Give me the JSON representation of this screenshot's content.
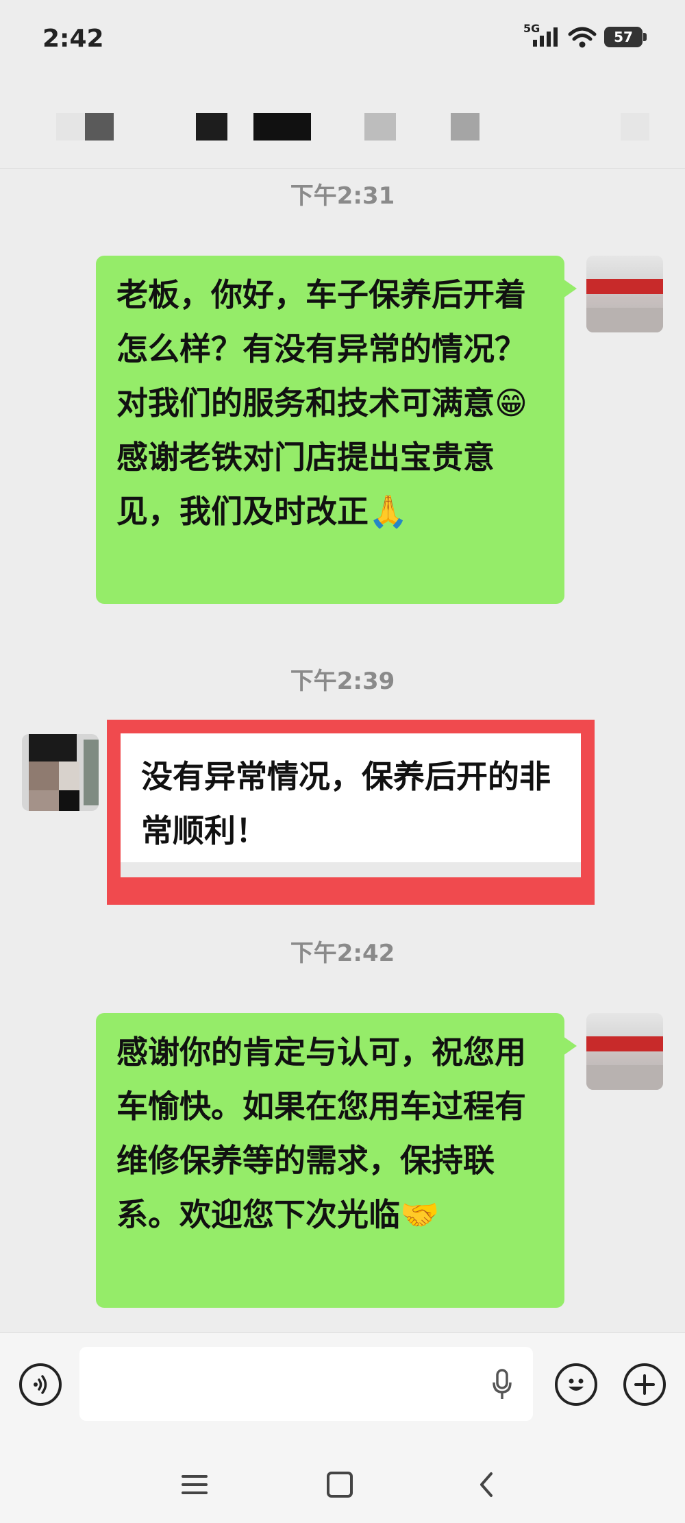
{
  "status_bar": {
    "time": "2:42",
    "signal_label": "5G",
    "battery_level": "57"
  },
  "messages": [
    {
      "type": "timestamp",
      "text": "下午2:31"
    },
    {
      "type": "sent",
      "text": "老板，你好，车子保养后开着怎么样？有没有异常的情况？对我们的服务和技术可满意😁感谢老铁对门店提出宝贵意见，我们及时改正🙏"
    },
    {
      "type": "timestamp",
      "text": "下午2:39"
    },
    {
      "type": "received",
      "text": "没有异常情况，保养后开的非常顺利！"
    },
    {
      "type": "timestamp",
      "text": "下午2:42"
    },
    {
      "type": "sent",
      "text": "感谢你的肯定与认可，祝您用车愉快。如果在您用车过程有维修保养等的需求，保持联系。欢迎您下次光临🤝"
    }
  ],
  "icons": {
    "voice": "voice-icon",
    "microphone": "microphone-icon",
    "emoji": "emoji-icon",
    "plus": "plus-icon",
    "nav_menu": "menu-icon",
    "nav_home": "home-icon",
    "nav_back": "back-icon"
  },
  "colors": {
    "sent_bubble": "#95ec69",
    "received_bubble": "#ffffff",
    "highlight_frame": "#f04a4e",
    "background": "#ededed"
  }
}
